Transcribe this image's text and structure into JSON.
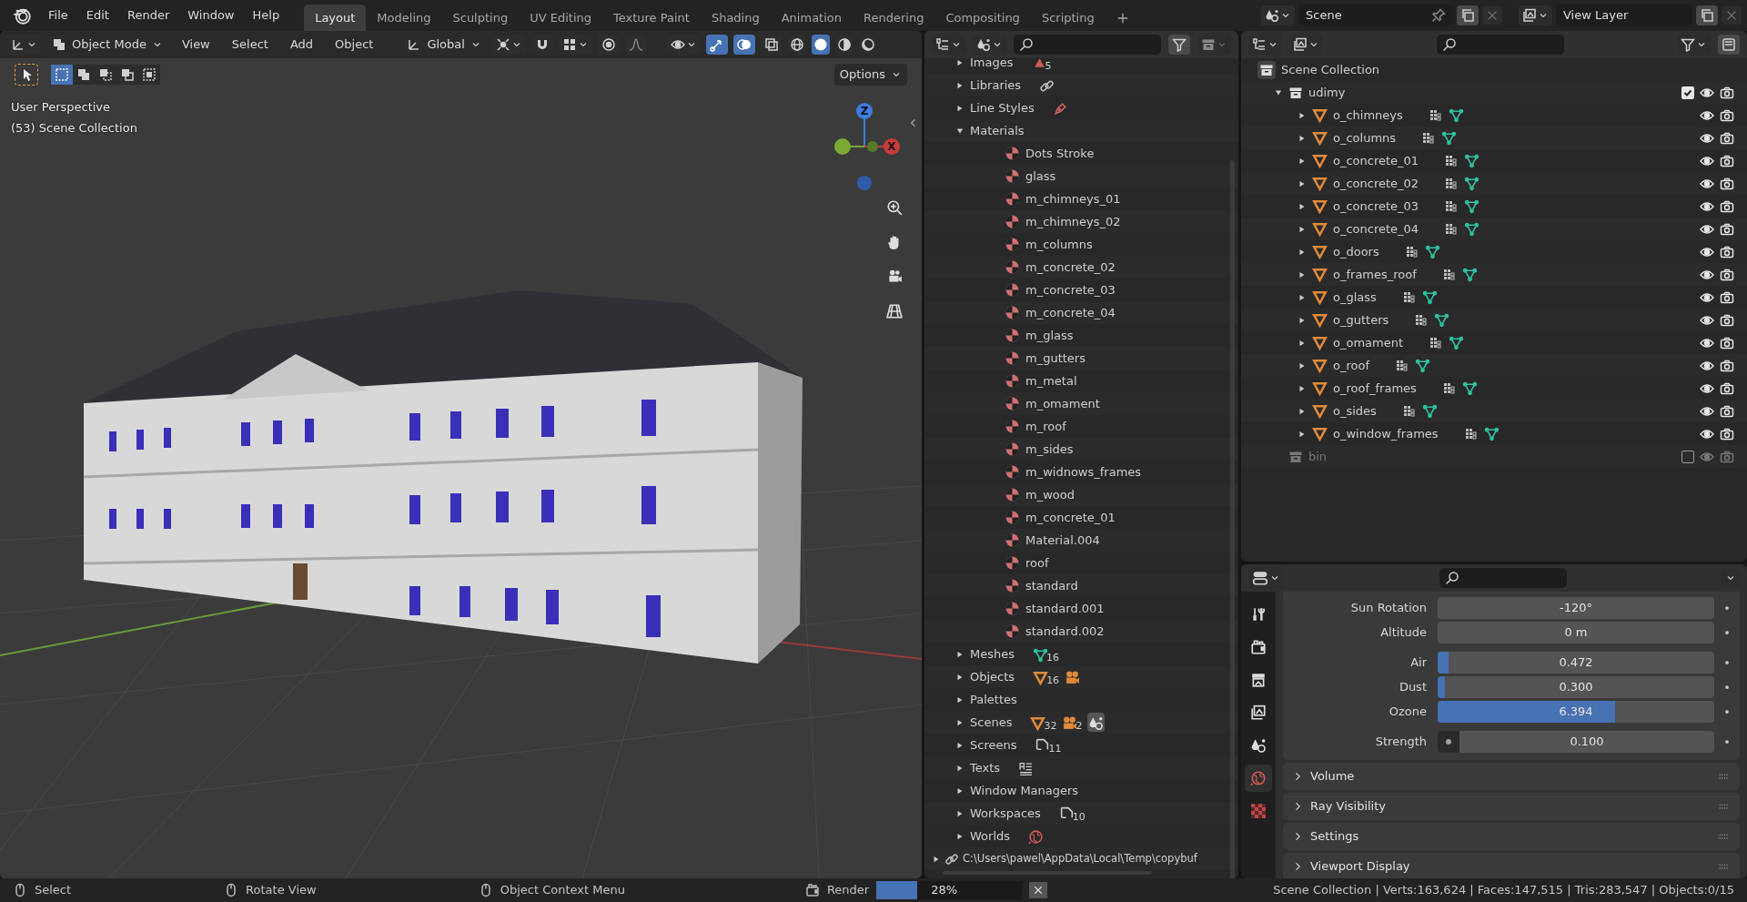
{
  "top_menu": [
    "File",
    "Edit",
    "Render",
    "Window",
    "Help"
  ],
  "workspace_tabs": [
    {
      "label": "Layout",
      "selected": true
    },
    {
      "label": "Modeling",
      "selected": false
    },
    {
      "label": "Sculpting",
      "selected": false
    },
    {
      "label": "UV Editing",
      "selected": false
    },
    {
      "label": "Texture Paint",
      "selected": false
    },
    {
      "label": "Shading",
      "selected": false
    },
    {
      "label": "Animation",
      "selected": false
    },
    {
      "label": "Rendering",
      "selected": false
    },
    {
      "label": "Compositing",
      "selected": false
    },
    {
      "label": "Scripting",
      "selected": false
    }
  ],
  "scene": "Scene",
  "view_layer": "View Layer",
  "viewport": {
    "mode": "Object Mode",
    "menus": [
      "View",
      "Select",
      "Add",
      "Object"
    ],
    "orientation": "Global",
    "toggles": {
      "snap": false,
      "proportional": false,
      "gizmos": true,
      "overlays": true,
      "xray": false
    },
    "shading": [
      {
        "selected": false
      },
      {
        "selected": true
      },
      {
        "selected": false
      },
      {
        "selected": false
      }
    ],
    "select_modes": [
      {
        "selected": true
      },
      {
        "selected": false
      },
      {
        "selected": false
      },
      {
        "selected": false
      },
      {
        "selected": false
      }
    ],
    "options": "Options",
    "overlay_lines": [
      "User Perspective",
      "(53) Scene Collection"
    ],
    "axis_labels": [
      "Z",
      "X"
    ]
  },
  "file_outliner": {
    "items": [
      {
        "label": "Images",
        "expanded": false,
        "badges": [
          {
            "count": "5"
          }
        ]
      },
      {
        "label": "Libraries",
        "expanded": false,
        "badges": [
          {
            "kind": "link"
          }
        ]
      },
      {
        "label": "Line Styles",
        "expanded": false,
        "badges": [
          {
            "kind": "brush"
          }
        ]
      },
      {
        "label": "Materials",
        "expanded": true,
        "children": [
          "Dots Stroke",
          "glass",
          "m_chimneys_01",
          "m_chimneys_02",
          "m_columns",
          "m_concrete_02",
          "m_concrete_03",
          "m_concrete_04",
          "m_glass",
          "m_gutters",
          "m_metal",
          "m_omament",
          "m_roof",
          "m_sides",
          "m_widnows_frames",
          "m_wood",
          "m_concrete_01",
          "Material.004",
          "roof",
          "standard",
          "standard.001",
          "standard.002"
        ]
      },
      {
        "label": "Meshes",
        "expanded": false,
        "badges": [
          {
            "kind": "mesh",
            "count": "16"
          }
        ]
      },
      {
        "label": "Objects",
        "expanded": false,
        "badges": [
          {
            "kind": "object",
            "count": "16"
          },
          {
            "kind": "movie"
          }
        ]
      },
      {
        "label": "Palettes",
        "expanded": false
      },
      {
        "label": "Scenes",
        "expanded": false,
        "badges": [
          {
            "kind": "object",
            "count": "32"
          },
          {
            "kind": "movie",
            "count": "2"
          },
          {
            "kind": "scene"
          }
        ]
      },
      {
        "label": "Screens",
        "expanded": false,
        "badges": [
          {
            "kind": "page",
            "count": "11"
          }
        ]
      },
      {
        "label": "Texts",
        "expanded": false,
        "badges": [
          {
            "kind": "text"
          }
        ]
      },
      {
        "label": "Window Managers",
        "expanded": false
      },
      {
        "label": "Workspaces",
        "expanded": false,
        "badges": [
          {
            "kind": "page",
            "count": "10"
          }
        ]
      },
      {
        "label": "Worlds",
        "expanded": false,
        "badges": [
          {
            "kind": "world"
          }
        ]
      }
    ],
    "library_path": "C:\\Users\\pawel\\AppData\\Local\\Temp\\copybuf"
  },
  "scene_outliner": {
    "root": "Scene Collection",
    "collections": [
      {
        "label": "udimy",
        "expanded": true,
        "checked": true,
        "children": [
          "o_chimneys",
          "o_columns",
          "o_concrete_01",
          "o_concrete_02",
          "o_concrete_03",
          "o_concrete_04",
          "o_doors",
          "o_frames_roof",
          "o_glass",
          "o_gutters",
          "o_omament",
          "o_roof",
          "o_roof_frames",
          "o_sides",
          "o_window_frames"
        ]
      },
      {
        "label": "bin",
        "checked": false
      }
    ]
  },
  "properties": {
    "tabs": [
      {
        "selected": false
      },
      {
        "selected": false
      },
      {
        "selected": false
      },
      {
        "selected": false
      },
      {
        "selected": false
      },
      {
        "selected": true
      },
      {
        "selected": false
      }
    ],
    "fields": [
      {
        "label": "Sun Rotation",
        "kind": "number",
        "value": "-120°"
      },
      {
        "label": "Altitude",
        "kind": "number",
        "value": "0 m"
      },
      {
        "label": "Air",
        "kind": "slider",
        "value": "0.472",
        "level": 0.04
      },
      {
        "label": "Dust",
        "kind": "slider",
        "value": "0.300",
        "level": 0.025
      },
      {
        "label": "Ozone",
        "kind": "slider",
        "value": "6.394",
        "level": 0.64
      },
      {
        "label": "Strength",
        "kind": "socket",
        "value": "0.100"
      }
    ],
    "panels": [
      "Volume",
      "Ray Visibility",
      "Settings",
      "Viewport Display"
    ]
  },
  "status_bar": {
    "hints": [
      "Select",
      "Rotate View",
      "Object Context Menu"
    ],
    "job": "Render",
    "progress": {
      "reading": "28%",
      "level": 0.28
    },
    "stats": "Scene Collection | Verts:163,624 | Faces:147,515 | Tris:283,547 | Objects:0/15"
  }
}
